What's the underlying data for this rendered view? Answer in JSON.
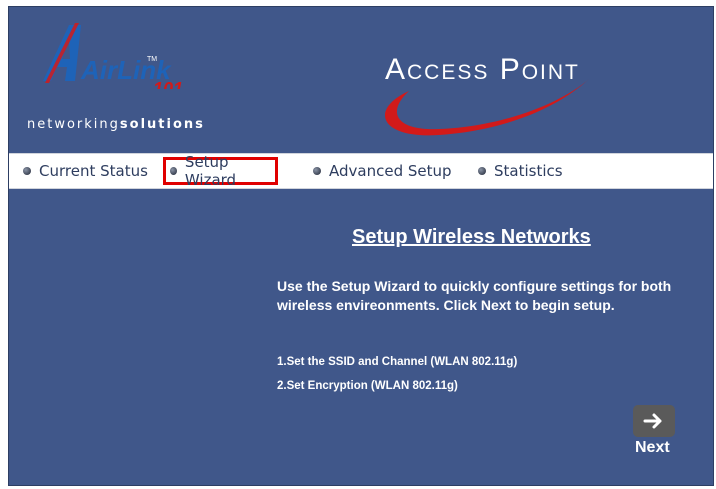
{
  "brand": {
    "logo_text": "AirLink",
    "logo_number": "101",
    "tm": "TM",
    "tagline_prefix": "networking",
    "tagline_suffix": "solutions"
  },
  "header": {
    "title": "Access Point"
  },
  "nav": {
    "items": [
      {
        "label": "Current Status"
      },
      {
        "label": "Setup Wizard",
        "active": true
      },
      {
        "label": "Advanced Setup"
      },
      {
        "label": "Statistics"
      }
    ]
  },
  "main": {
    "title": "Setup Wireless Networks",
    "intro_line1": "Use the Setup Wizard to quickly configure settings for both",
    "intro_line2": "wireless envireonments. Click Next to begin setup.",
    "steps": [
      "1.Set the SSID and Channel (WLAN 802.11g)",
      "2.Set Encryption (WLAN 802.11g)"
    ],
    "next_label": "Next"
  },
  "colors": {
    "background": "#40578a",
    "nav_background": "#ffffff",
    "active_outline": "#e00000",
    "logo_red": "#d21a1a",
    "logo_blue": "#1e63b8"
  }
}
